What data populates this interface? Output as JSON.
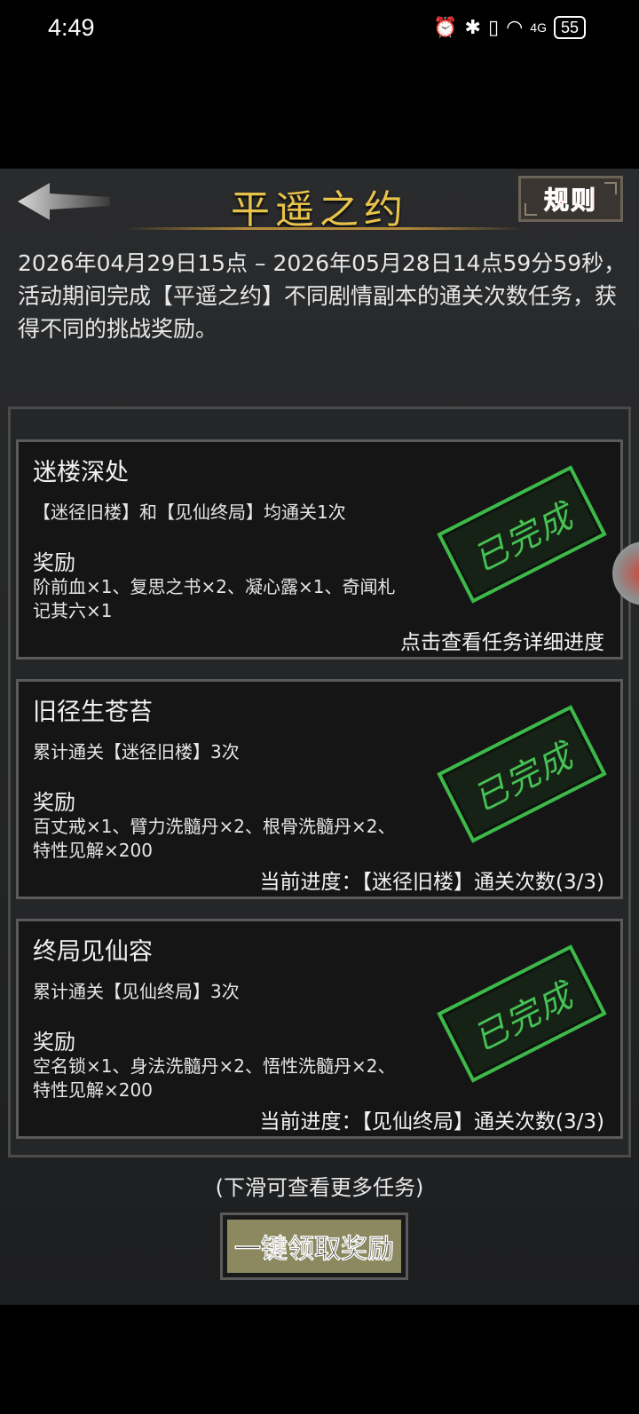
{
  "status_bar": {
    "time": "4:49",
    "icons": [
      "alarm-icon",
      "bluetooth-icon",
      "vibrate-icon",
      "wifi-icon",
      "signal-4g-icon"
    ],
    "signal_label": "4G",
    "battery": "55"
  },
  "header": {
    "title": "平遥之约",
    "rule_label": "规则"
  },
  "intro": "2026年04月29日15点 – 2026年05月28日14点59分59秒，活动期间完成【平遥之约】不同剧情副本的通关次数任务，获得不同的挑战奖励。",
  "tasks": [
    {
      "title": "迷楼深处",
      "condition": "【迷径旧楼】和【见仙终局】均通关1次",
      "reward_label": "奖励",
      "rewards": "阶前血×1、复思之书×2、凝心露×1、奇闻札记其六×1",
      "progress": "点击查看任务详细进度",
      "stamp": "已完成"
    },
    {
      "title": "旧径生苍苔",
      "condition": "累计通关【迷径旧楼】3次",
      "reward_label": "奖励",
      "rewards": "百丈戒×1、臂力洗髓丹×2、根骨洗髓丹×2、特性见解×200",
      "progress": "当前进度：【迷径旧楼】通关次数(3/3)",
      "stamp": "已完成"
    },
    {
      "title": "终局见仙容",
      "condition": "累计通关【见仙终局】3次",
      "reward_label": "奖励",
      "rewards": "空名锁×1、身法洗髓丹×2、悟性洗髓丹×2、特性见解×200",
      "progress": "当前进度：【见仙终局】通关次数(3/3)",
      "stamp": "已完成"
    }
  ],
  "footer": {
    "hint": "(下滑可查看更多任务)",
    "claim_label": "一键领取奖励"
  },
  "colors": {
    "title_gold": "#e8c34a",
    "rule_red": "#ff2a22",
    "stamp_green": "#3db94a",
    "claim_bg": "#8c8960"
  }
}
